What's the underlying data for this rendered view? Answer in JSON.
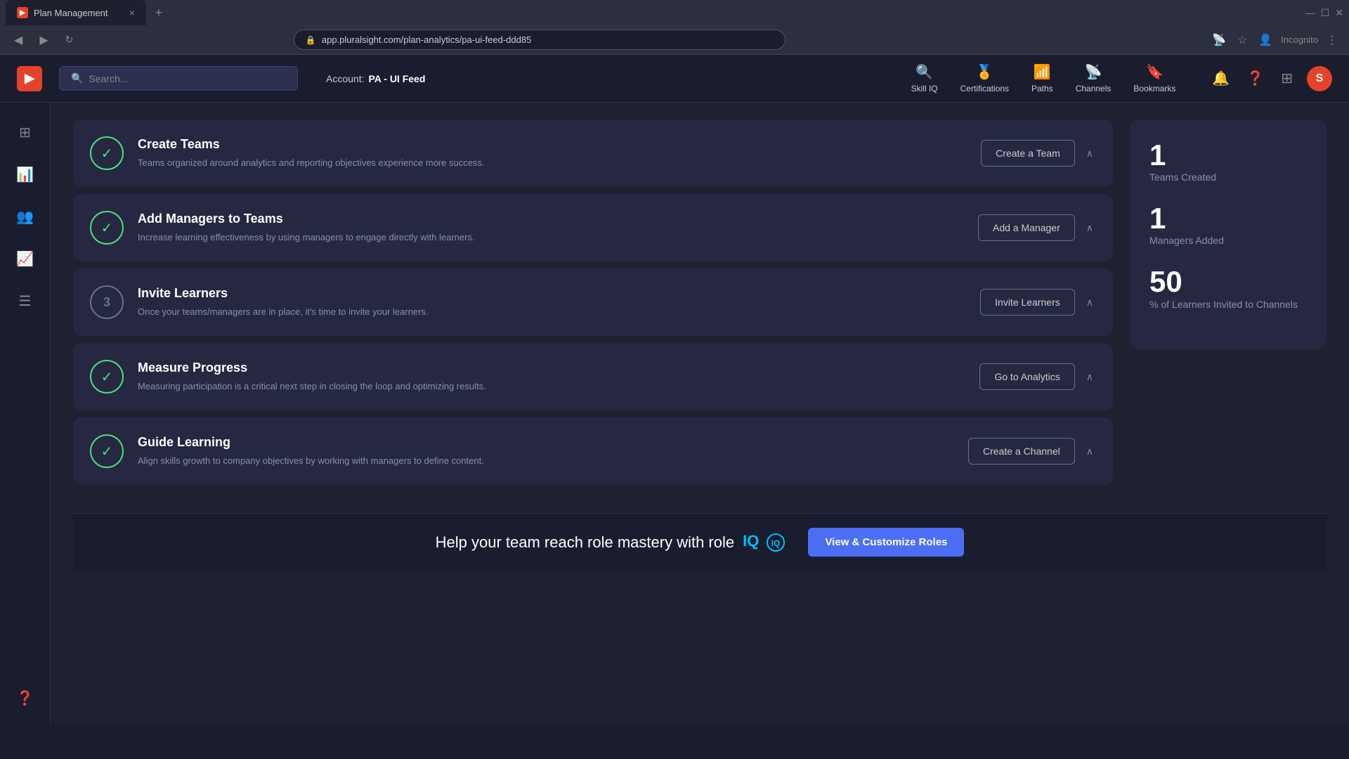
{
  "browser": {
    "tab_title": "Plan Management",
    "url": "app.pluralsight.com/plan-analytics/pa-ui-feed-ddd85",
    "tab_close": "×"
  },
  "header": {
    "search_placeholder": "Search...",
    "account_label": "Account:",
    "account_name": "PA - UI Feed",
    "nav_items": [
      {
        "id": "skill-iq",
        "label": "Skill IQ",
        "icon": "🔍"
      },
      {
        "id": "certifications",
        "label": "Certifications",
        "icon": "🏅"
      },
      {
        "id": "paths",
        "label": "Paths",
        "icon": "📶"
      },
      {
        "id": "channels",
        "label": "Channels",
        "icon": "📡"
      },
      {
        "id": "bookmarks",
        "label": "Bookmarks",
        "icon": "🔖"
      }
    ],
    "avatar_letter": "S"
  },
  "sidebar": {
    "items": [
      {
        "id": "dashboard",
        "icon": "⊞"
      },
      {
        "id": "analytics",
        "icon": "📊"
      },
      {
        "id": "teams",
        "icon": "👥"
      },
      {
        "id": "reports",
        "icon": "📈"
      },
      {
        "id": "content",
        "icon": "☰"
      }
    ]
  },
  "steps": [
    {
      "id": "create-teams",
      "completed": true,
      "number": "✓",
      "title": "Create Teams",
      "description": "Teams organized around analytics and reporting objectives experience more success.",
      "action_label": "Create a Team"
    },
    {
      "id": "add-managers",
      "completed": true,
      "number": "✓",
      "title": "Add Managers to Teams",
      "description": "Increase learning effectiveness by using managers to engage directly with learners.",
      "action_label": "Add a Manager"
    },
    {
      "id": "invite-learners",
      "completed": false,
      "number": "3",
      "title": "Invite Learners",
      "description": "Once your teams/managers are in place, it's time to invite your learners.",
      "action_label": "Invite Learners"
    },
    {
      "id": "measure-progress",
      "completed": true,
      "number": "✓",
      "title": "Measure Progress",
      "description": "Measuring participation is a critical next step in closing the loop and optimizing results.",
      "action_label": "Go to Analytics"
    },
    {
      "id": "guide-learning",
      "completed": true,
      "number": "✓",
      "title": "Guide Learning",
      "description": "Align skills growth to company objectives by working with managers to define content.",
      "action_label": "Create a Channel"
    }
  ],
  "stats": [
    {
      "id": "teams-created",
      "value": "1",
      "label": "Teams Created"
    },
    {
      "id": "managers-added",
      "value": "1",
      "label": "Managers Added"
    },
    {
      "id": "learners-invited",
      "value": "50",
      "label": "% of Learners Invited to Channels"
    }
  ],
  "banner": {
    "text_before": "Help your team reach role mastery with role",
    "iq_text": "IQ",
    "button_label": "View & Customize Roles"
  }
}
